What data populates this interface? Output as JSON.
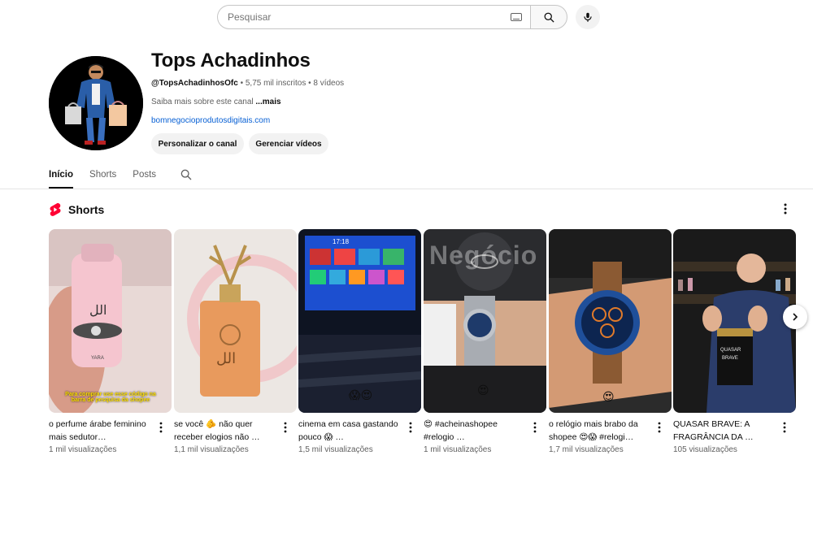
{
  "search": {
    "placeholder": "Pesquisar"
  },
  "channel": {
    "name": "Tops Achadinhos",
    "handle": "@TopsAchadinhosOfc",
    "meta": " • 5,75 mil inscritos • 8 vídeos",
    "description": "Saiba mais sobre este canal ",
    "description_more": "...mais",
    "link": "bomnegocioprodutosdigitais.com",
    "btn_customize": "Personalizar o canal",
    "btn_manage": "Gerenciar vídeos"
  },
  "tabs": [
    "Início",
    "Shorts",
    "Posts"
  ],
  "shorts": {
    "title": "Shorts",
    "items": [
      {
        "title": "o perfume árabe feminino mais sedutor…",
        "views": "1 mil visualizações",
        "overlay": "Para comprar use esse código na barra de pesquisa da shopee"
      },
      {
        "title": "se você 🫵 não quer receber elogios não …",
        "views": "1,1 mil visualizações"
      },
      {
        "title": "cinema em casa gastando pouco 😱 …",
        "views": "1,5 mil visualizações",
        "overlay_emoji": "😱😍"
      },
      {
        "title": "😍 #acheinashopee #relogio …",
        "views": "1 mil visualizações",
        "overlay_emoji": "😍"
      },
      {
        "title": "o relógio mais brabo da shopee 😍😱 #relogi…",
        "views": "1,7 mil visualizações",
        "overlay_emoji": "😍"
      },
      {
        "title": "QUASAR BRAVE: A FRAGRÂNCIA DA …",
        "views": "105 visualizações"
      }
    ],
    "tv_time": "17:18",
    "watermark": "Negócio"
  },
  "colors": {
    "link": "#065fd4",
    "shorts_red": "#ff0033",
    "muted": "#606060"
  }
}
